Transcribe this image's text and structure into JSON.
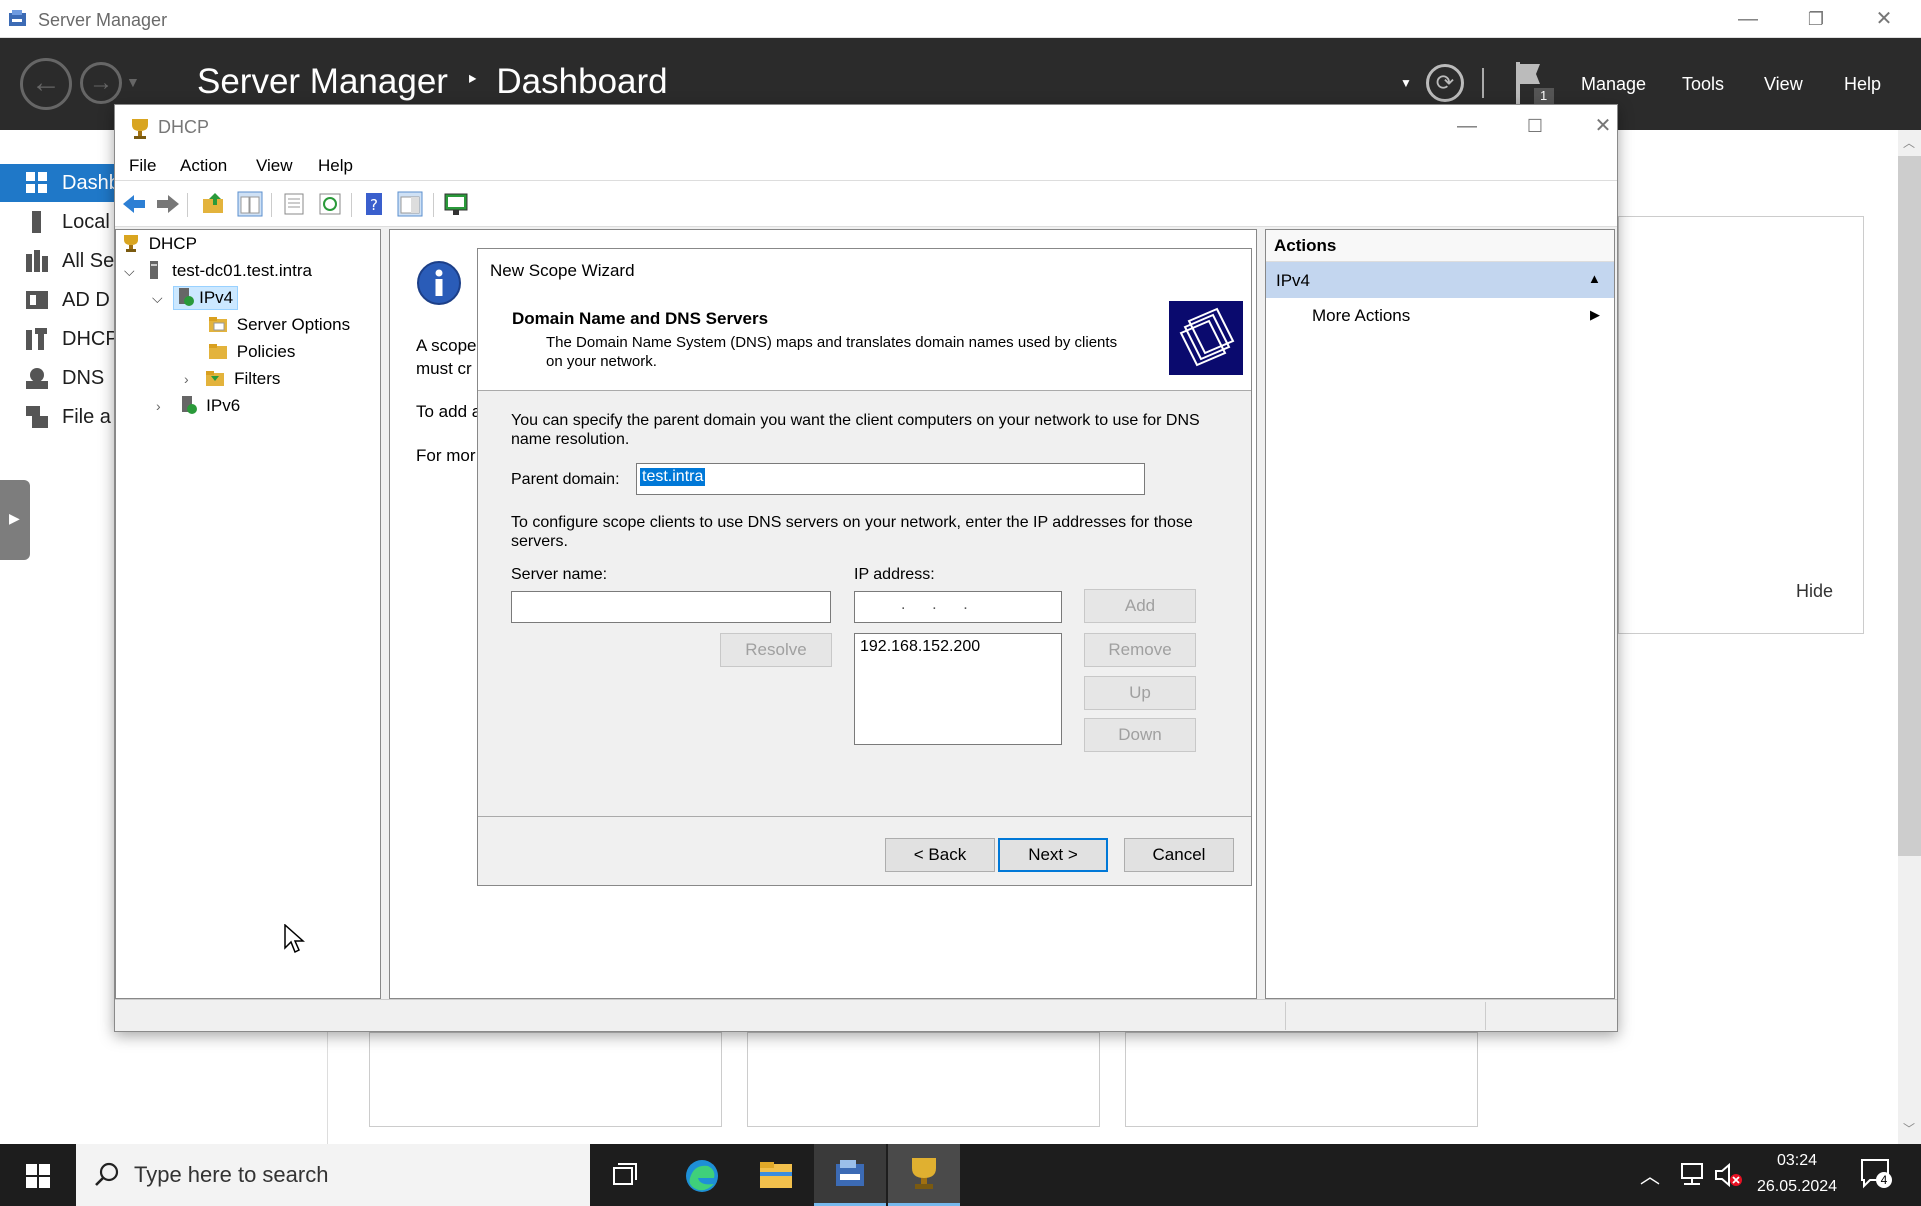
{
  "sm": {
    "window_title": "Server Manager",
    "breadcrumb_root": "Server Manager",
    "breadcrumb_sep": "‣",
    "breadcrumb_page": "Dashboard",
    "menu": {
      "manage": "Manage",
      "tools": "Tools",
      "view": "View",
      "help": "Help"
    },
    "flag_count": "1",
    "left_items": [
      {
        "label": "Dashb",
        "icon": "dashboard-icon"
      },
      {
        "label": "Local",
        "icon": "local-server-icon"
      },
      {
        "label": "All Se",
        "icon": "all-servers-icon"
      },
      {
        "label": "AD D",
        "icon": "ad-ds-icon"
      },
      {
        "label": "DHCP",
        "icon": "dhcp-icon"
      },
      {
        "label": "DNS",
        "icon": "dns-icon"
      },
      {
        "label": "File a",
        "icon": "file-services-icon"
      }
    ],
    "hide_label": "Hide"
  },
  "dhcp": {
    "title": "DHCP",
    "menu": [
      "File",
      "Action",
      "View",
      "Help"
    ],
    "tree": {
      "root": "DHCP",
      "server": "test-dc01.test.intra",
      "ipv4": "IPv4",
      "server_options": "Server Options",
      "policies": "Policies",
      "filters": "Filters",
      "ipv6": "IPv6"
    },
    "center_text": [
      "A scope",
      "must cr",
      "To add a",
      "For mor"
    ],
    "actions": {
      "header": "Actions",
      "section": "IPv4",
      "more_actions": "More Actions"
    }
  },
  "wizard": {
    "title": "New Scope Wizard",
    "heading": "Domain Name and DNS Servers",
    "subheading": "The Domain Name System (DNS) maps and translates domain names used by clients on your network.",
    "intro": "You can specify the parent domain you want the client computers on your network to use for DNS name resolution.",
    "parent_domain_label": "Parent domain:",
    "parent_domain_value": "test.intra",
    "dns_text": "To configure scope clients to use DNS servers on your network, enter the IP addresses for those servers.",
    "server_name_label": "Server name:",
    "ip_address_label": "IP address:",
    "ip_dots": ".      .      .",
    "ip_list": [
      "192.168.152.200"
    ],
    "buttons": {
      "add": "Add",
      "resolve": "Resolve",
      "remove": "Remove",
      "up": "Up",
      "down": "Down",
      "back": "< Back",
      "next": "Next >",
      "cancel": "Cancel"
    }
  },
  "taskbar": {
    "search_placeholder": "Type here to search",
    "time": "03:24",
    "date": "26.05.2024",
    "notification_count": "4"
  }
}
